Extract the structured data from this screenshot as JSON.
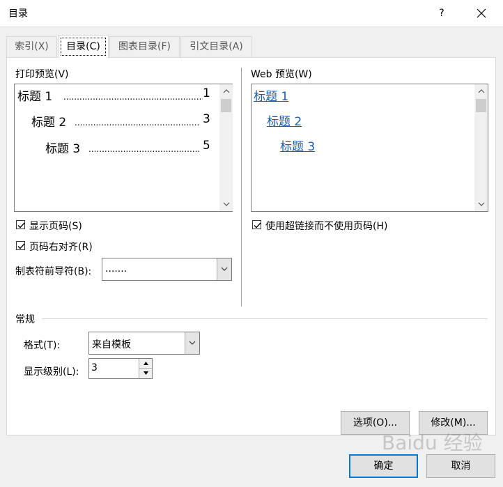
{
  "window": {
    "title": "目录",
    "help_label": "?",
    "close_icon": "close-icon"
  },
  "tabs": [
    {
      "label": "索引(X)",
      "active": false
    },
    {
      "label": "目录(C)",
      "active": true
    },
    {
      "label": "图表目录(F)",
      "active": false
    },
    {
      "label": "引文目录(A)",
      "active": false
    }
  ],
  "print_preview": {
    "label": "打印预览(V)",
    "entries": [
      {
        "text": "标题 1",
        "page": "1"
      },
      {
        "text": "标题 2",
        "page": "3"
      },
      {
        "text": "标题 3",
        "page": "5"
      }
    ]
  },
  "web_preview": {
    "label": "Web 预览(W)",
    "entries": [
      "标题 1",
      "标题 2",
      "标题 3"
    ]
  },
  "options": {
    "show_page_numbers": {
      "label": "显示页码(S)",
      "checked": true
    },
    "right_align": {
      "label": "页码右对齐(R)",
      "checked": true
    },
    "use_hyperlinks": {
      "label": "使用超链接而不使用页码(H)",
      "checked": true
    },
    "tab_leader": {
      "label": "制表符前导符(B):",
      "value": "......."
    }
  },
  "general": {
    "section_label": "常规",
    "format": {
      "label": "格式(T):",
      "value": "来自模板"
    },
    "levels": {
      "label": "显示级别(L):",
      "value": "3"
    }
  },
  "buttons": {
    "options": "选项(O)...",
    "modify": "修改(M)...",
    "ok": "确定",
    "cancel": "取消"
  },
  "watermark": "Baidu 经验",
  "colors": {
    "link": "#1a5ea8",
    "accent": "#0078d7"
  }
}
